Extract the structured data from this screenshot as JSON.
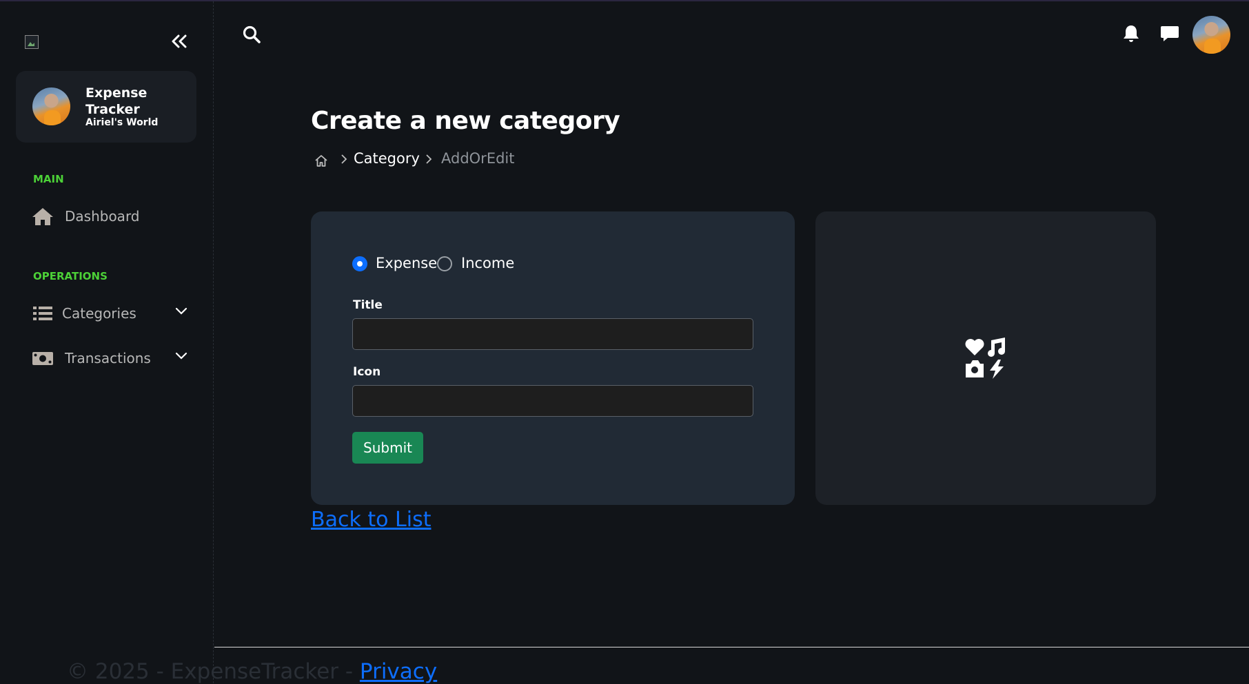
{
  "app": {
    "name": "Expense Tracker",
    "subtitle": "Airiel's World"
  },
  "sidebar": {
    "sections": [
      {
        "label": "MAIN"
      },
      {
        "label": "OPERATIONS"
      }
    ],
    "items": [
      {
        "label": "Dashboard",
        "icon": "home-icon"
      },
      {
        "label": "Categories",
        "icon": "list-icon",
        "expandable": true
      },
      {
        "label": "Transactions",
        "icon": "money-icon",
        "expandable": true
      }
    ]
  },
  "page": {
    "title": "Create a new category",
    "breadcrumb": [
      "Category",
      "AddOrEdit"
    ]
  },
  "form": {
    "type_options": [
      {
        "label": "Expense",
        "checked": true
      },
      {
        "label": "Income",
        "checked": false
      }
    ],
    "title_label": "Title",
    "title_value": "",
    "icon_label": "Icon",
    "icon_value": "",
    "submit_label": "Submit"
  },
  "back_link": "Back to List",
  "footer": {
    "text": "© 2025 - ExpenseTracker - ",
    "link": "Privacy"
  },
  "colors": {
    "accent": "#0d6efd",
    "section_label": "#4cd137",
    "submit": "#198754",
    "background": "#111418"
  }
}
